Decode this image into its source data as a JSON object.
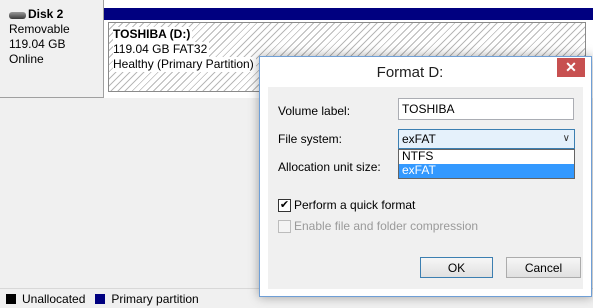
{
  "disk": {
    "name": "Disk 2",
    "type": "Removable",
    "size": "119.04 GB",
    "status": "Online"
  },
  "partition": {
    "name": "TOSHIBA  (D:)",
    "details": "119.04 GB FAT32",
    "health": "Healthy (Primary Partition)",
    "bar_color": "#000080"
  },
  "legend": [
    {
      "label": "Unallocated",
      "color": "#000000"
    },
    {
      "label": "Primary partition",
      "color": "#000080"
    }
  ],
  "dialog": {
    "title": "Format D:",
    "close_icon": "close-icon",
    "volume_label": {
      "label": "Volume label:",
      "value": "TOSHIBA"
    },
    "file_system": {
      "label": "File system:",
      "value": "exFAT",
      "options": [
        "NTFS",
        "exFAT"
      ],
      "highlighted": "exFAT"
    },
    "allocation": {
      "label": "Allocation unit size:"
    },
    "quick_format": {
      "label": "Perform a quick format",
      "checked": true
    },
    "compression": {
      "label": "Enable file and folder compression",
      "checked": false,
      "enabled": false
    },
    "ok_label": "OK",
    "cancel_label": "Cancel"
  }
}
